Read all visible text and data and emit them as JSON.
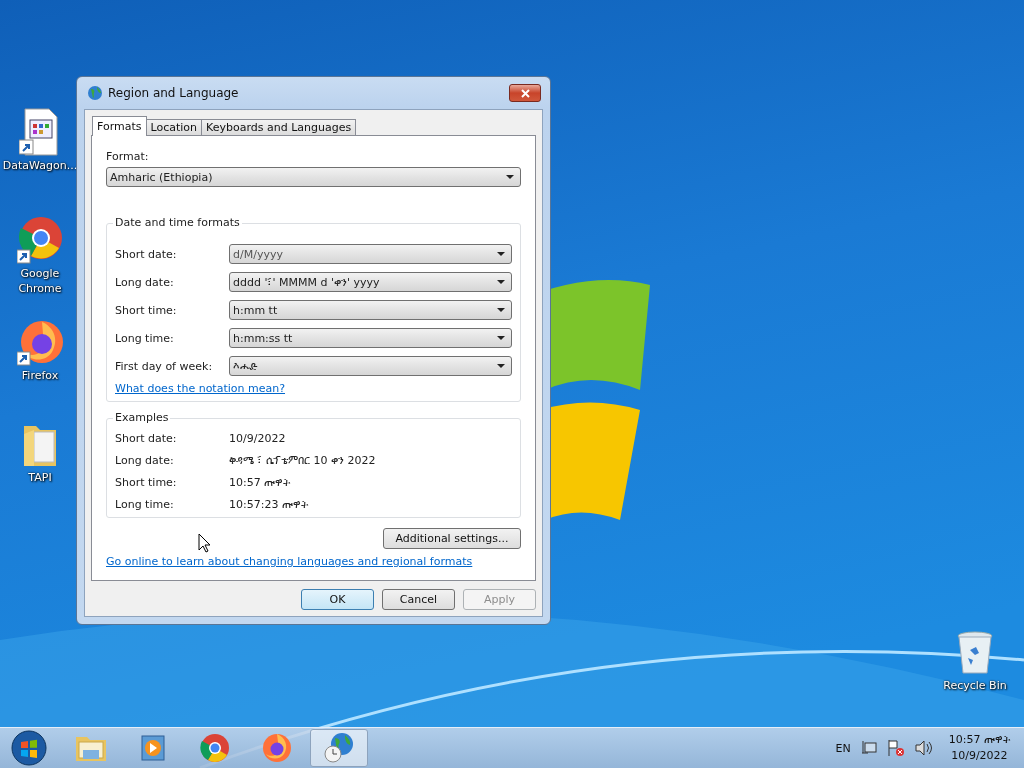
{
  "desktop_icons": [
    {
      "label": "DataWagon...",
      "kind": "app"
    },
    {
      "label": "Google Chrome",
      "kind": "chrome"
    },
    {
      "label": "Firefox",
      "kind": "firefox"
    },
    {
      "label": "TAPI",
      "kind": "folder"
    },
    {
      "label": "Recycle Bin",
      "kind": "bin"
    }
  ],
  "dialog": {
    "title": "Region and Language",
    "tabs": [
      {
        "label": "Formats",
        "selected": true
      },
      {
        "label": "Location",
        "selected": false
      },
      {
        "label": "Keyboards and Languages",
        "selected": false
      }
    ],
    "format_label": "Format:",
    "format_value": "Amharic (Ethiopia)",
    "date_time_formats": {
      "title": "Date and time formats",
      "rows": [
        {
          "label": "Short date:",
          "value": "d/M/yyyy"
        },
        {
          "label": "Long date:",
          "value": "dddd '፣' MMMM d 'ቀን' yyyy"
        },
        {
          "label": "Short time:",
          "value": "h:mm tt"
        },
        {
          "label": "Long time:",
          "value": "h:mm:ss tt"
        },
        {
          "label": "First day of week:",
          "value": "እሑድ"
        }
      ]
    },
    "notation_link": "What does the notation mean?",
    "examples": {
      "title": "Examples",
      "rows": [
        {
          "label": "Short date:",
          "value": "10/9/2022"
        },
        {
          "label": "Long date:",
          "value": "ቅዳሜ ፣ ሴፕቴምበር 10 ቀን 2022"
        },
        {
          "label": "Short time:",
          "value": "10:57 ጡዋት"
        },
        {
          "label": "Long time:",
          "value": "10:57:23 ጡዋት"
        }
      ]
    },
    "additional_settings": "Additional settings...",
    "online_link": "Go online to learn about changing languages and regional formats",
    "buttons": [
      {
        "label": "OK",
        "default": true,
        "disabled": false
      },
      {
        "label": "Cancel",
        "default": false,
        "disabled": false
      },
      {
        "label": "Apply",
        "default": false,
        "disabled": true
      }
    ]
  },
  "taskbar": {
    "apps": [
      {
        "kind": "start",
        "selected": false
      },
      {
        "kind": "explorer",
        "selected": false
      },
      {
        "kind": "media",
        "selected": false
      },
      {
        "kind": "chrome",
        "selected": false
      },
      {
        "kind": "firefox",
        "selected": false
      },
      {
        "kind": "region",
        "selected": true
      }
    ],
    "language": "EN",
    "time": "10:57 ጡዋት",
    "date": "10/9/2022"
  }
}
